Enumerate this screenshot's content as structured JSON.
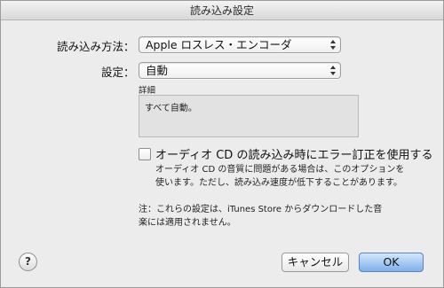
{
  "window": {
    "title": "読み込み設定"
  },
  "import_method": {
    "label": "読み込み方法：",
    "value": "Apple ロスレス・エンコーダ"
  },
  "settings": {
    "label": "設定：",
    "value": "自動"
  },
  "details": {
    "label": "詳細",
    "text": "すべて自動。"
  },
  "error_correction": {
    "label": "オーディオ CD の読み込み時にエラー訂正を使用する",
    "checked": false,
    "description_line1": "オーディオ CD の音質に問題がある場合は、このオプションを",
    "description_line2": "使います。ただし、読み込み速度が低下することがあります。"
  },
  "note": {
    "line1": "注：これらの設定は、iTunes Store からダウンロードした音",
    "line2": "楽には適用されません。"
  },
  "help": {
    "symbol": "?",
    "icon": "help-icon"
  },
  "buttons": {
    "cancel": "キャンセル",
    "ok": "OK"
  },
  "colors": {
    "ok_button": "#7fb0ec",
    "background": "#ececec"
  }
}
